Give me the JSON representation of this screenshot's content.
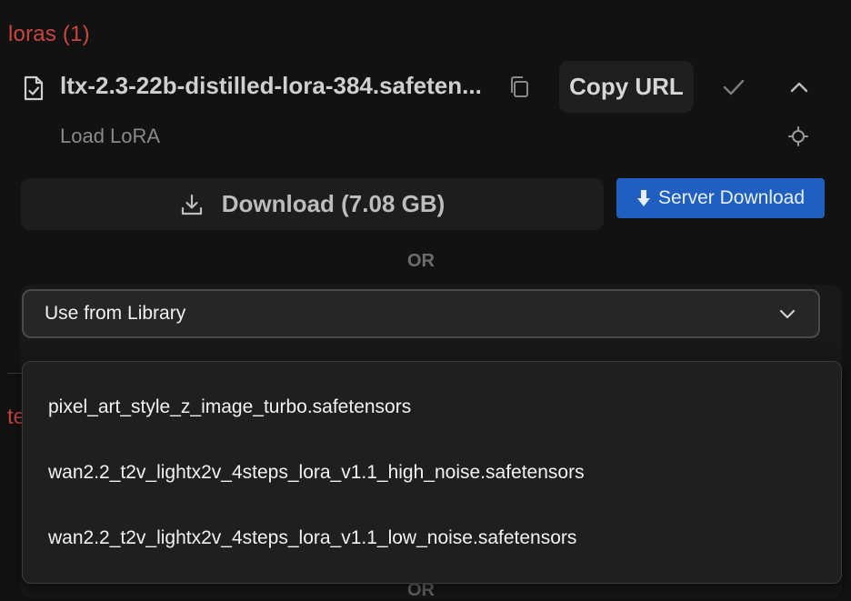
{
  "section": {
    "title": "loras (1)"
  },
  "file": {
    "name": "ltx-2.3-22b-distilled-lora-384.safeten...",
    "subtitle": "Load LoRA",
    "copy_url_label": "Copy URL"
  },
  "download": {
    "label": "Download (7.08 GB)",
    "server_label": "Server Download"
  },
  "separator": {
    "or": "OR"
  },
  "library": {
    "select_label": "Use from Library",
    "options": [
      "pixel_art_style_z_image_turbo.safetensors",
      "wan2.2_t2v_lightx2v_4steps_lora_v1.1_high_noise.safetensors",
      "wan2.2_t2v_lightx2v_4steps_lora_v1.1_low_noise.safetensors"
    ]
  },
  "next_section": {
    "title_partial": "te"
  },
  "colors": {
    "background": "#121212",
    "section_title": "#c94640",
    "server_button": "#1f5fbf"
  },
  "icons": [
    "file-check-icon",
    "copy-icon",
    "check-icon",
    "chevron-up-icon",
    "target-icon",
    "download-icon",
    "arrow-down-icon",
    "chevron-down-icon"
  ]
}
